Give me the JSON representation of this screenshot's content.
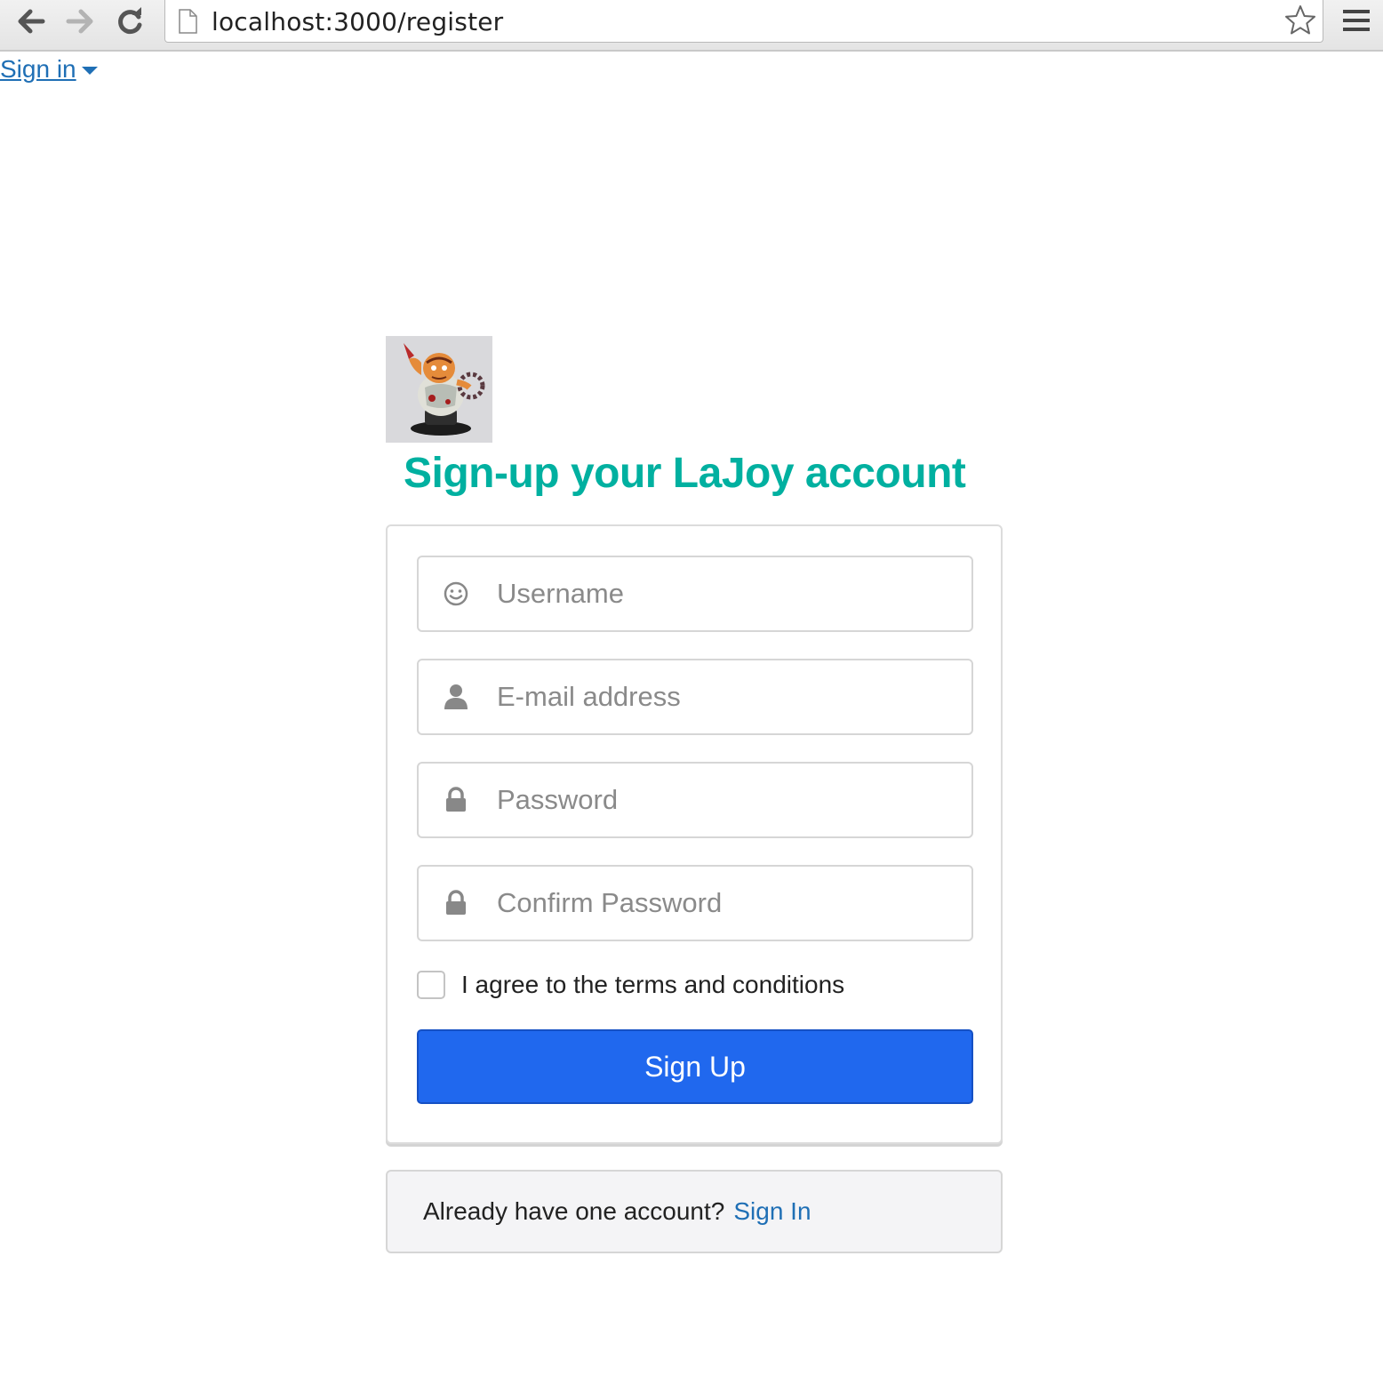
{
  "browser": {
    "url": "localhost:3000/register"
  },
  "nav": {
    "signin_label": "Sign in"
  },
  "page": {
    "title": "Sign-up your LaJoy account",
    "accent_color": "#00b0a0",
    "link_color": "#1f6fb5",
    "button_color": "#2068ee"
  },
  "form": {
    "username": {
      "placeholder": "Username",
      "value": "",
      "icon": "smile-icon"
    },
    "email": {
      "placeholder": "E-mail address",
      "value": "",
      "icon": "user-icon"
    },
    "password": {
      "placeholder": "Password",
      "value": "",
      "icon": "lock-icon"
    },
    "confirm_password": {
      "placeholder": "Confirm Password",
      "value": "",
      "icon": "lock-icon"
    },
    "terms_label": "I agree to the terms and conditions",
    "terms_checked": false,
    "submit_label": "Sign Up"
  },
  "footer": {
    "prompt": "Already have one account?",
    "link_label": "Sign In"
  }
}
